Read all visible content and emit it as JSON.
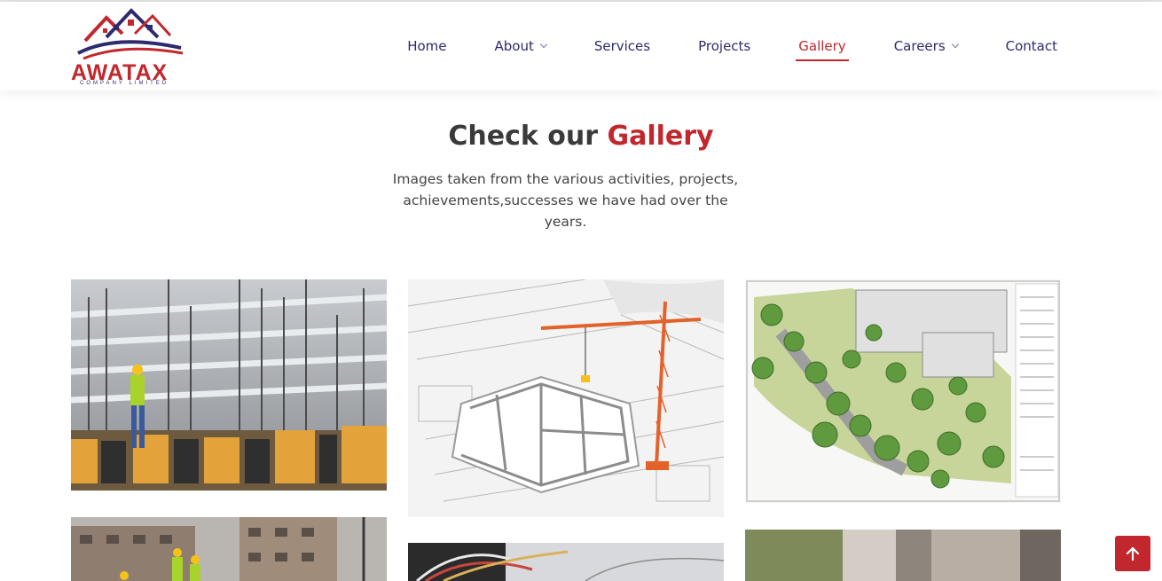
{
  "brand": {
    "name": "AWATAX",
    "tagline": "COMPANY LIMITED",
    "primary_color": "#c1272d",
    "secondary_color": "#2d2a6e"
  },
  "nav": {
    "items": [
      {
        "label": "Home",
        "dropdown": false,
        "active": false
      },
      {
        "label": "About",
        "dropdown": true,
        "active": false
      },
      {
        "label": "Services",
        "dropdown": false,
        "active": false
      },
      {
        "label": "Projects",
        "dropdown": false,
        "active": false
      },
      {
        "label": "Gallery",
        "dropdown": false,
        "active": true
      },
      {
        "label": "Careers",
        "dropdown": true,
        "active": false
      },
      {
        "label": "Contact",
        "dropdown": false,
        "active": false
      }
    ]
  },
  "gallery": {
    "title_prefix": "Check our ",
    "title_accent": "Gallery",
    "description": "Images taken from the various activities, projects, achievements,successes we have had over the years.",
    "images": [
      {
        "subject": "construction-site-rebar"
      },
      {
        "subject": "blueprint-crane-model"
      },
      {
        "subject": "landscape-site-plan"
      },
      {
        "subject": "building-workers-hardhats"
      },
      {
        "subject": "electrical-wiring"
      },
      {
        "subject": "stone-columns"
      }
    ]
  },
  "scroll_top": {
    "icon": "arrow-up-icon"
  }
}
